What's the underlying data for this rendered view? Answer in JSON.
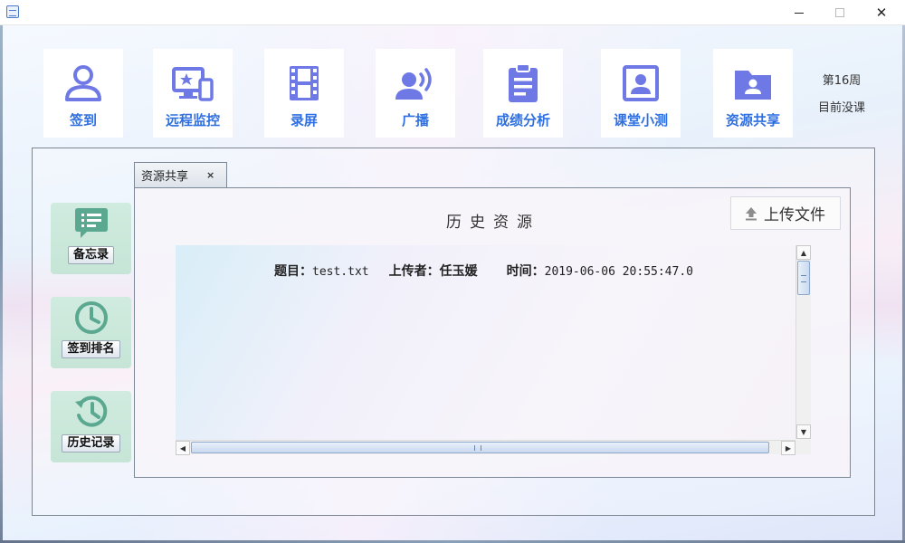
{
  "window": {
    "minimize_glyph": "",
    "close_glyph": "✕"
  },
  "toolbar": {
    "items": [
      {
        "label": "签到",
        "icon": "user-icon"
      },
      {
        "label": "远程监控",
        "icon": "remote-monitor-icon"
      },
      {
        "label": "录屏",
        "icon": "film-icon"
      },
      {
        "label": "广播",
        "icon": "broadcast-icon"
      },
      {
        "label": "成绩分析",
        "icon": "clipboard-icon"
      },
      {
        "label": "课堂小测",
        "icon": "portrait-icon"
      },
      {
        "label": "资源共享",
        "icon": "folder-icon"
      }
    ],
    "accent": "#2f6fe0",
    "icon_color": "#6f79e6"
  },
  "status": {
    "week": "第16周",
    "class_status": "目前没课"
  },
  "sidebar": {
    "items": [
      {
        "label": "备忘录",
        "icon": "memo-icon"
      },
      {
        "label": "签到排名",
        "icon": "clock-icon"
      },
      {
        "label": "历史记录",
        "icon": "history-icon"
      }
    ],
    "bg_color": "#c6e5d7",
    "icon_color": "#5aa890"
  },
  "tab": {
    "label": "资源共享",
    "close": "×"
  },
  "content": {
    "title": "历史资源",
    "upload_label": "上传文件",
    "records": [
      {
        "title_key": "题目：",
        "title_val": "test.txt",
        "uploader_key": "上传者：",
        "uploader_val": "任玉媛",
        "time_key": "时间：",
        "time_val": "2019-06-06 20:55:47.0"
      }
    ]
  },
  "scroll": {
    "up": "▲",
    "down": "▼",
    "left": "◀",
    "right": "▶"
  }
}
